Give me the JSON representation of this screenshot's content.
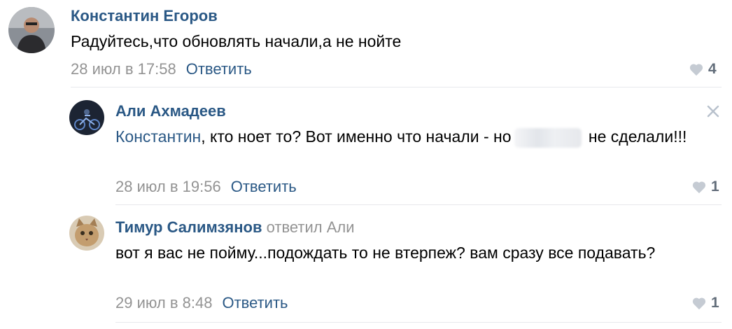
{
  "comments": [
    {
      "author": "Константин Егоров",
      "text": "Радуйтесь,что обновлять начали,а не нойте",
      "time": "28 июл в 17:58",
      "reply": "Ответить",
      "likes": "4",
      "avatar": "avatar-photo-man"
    },
    {
      "author": "Али Ахмадеев",
      "mention": "Константин",
      "text_before_redaction": ", кто ноет то? Вот именно что начали - но",
      "text_after_redaction": " не сделали!!!",
      "time": "28 июл в 19:56",
      "reply": "Ответить",
      "likes": "1",
      "avatar": "avatar-photo-motorcycle"
    },
    {
      "author": "Тимур Салимзянов",
      "replied_to": "ответил Али",
      "text": "вот я вас не пойму...подождать то не втерпеж? вам сразу все подавать?",
      "time": "29 июл в 8:48",
      "reply": "Ответить",
      "likes": "1",
      "avatar": "avatar-photo-cat"
    }
  ],
  "colors": {
    "link": "#2a5885",
    "muted": "#939393",
    "divider": "#e7e8ec",
    "heart": "#c5cbd3"
  }
}
